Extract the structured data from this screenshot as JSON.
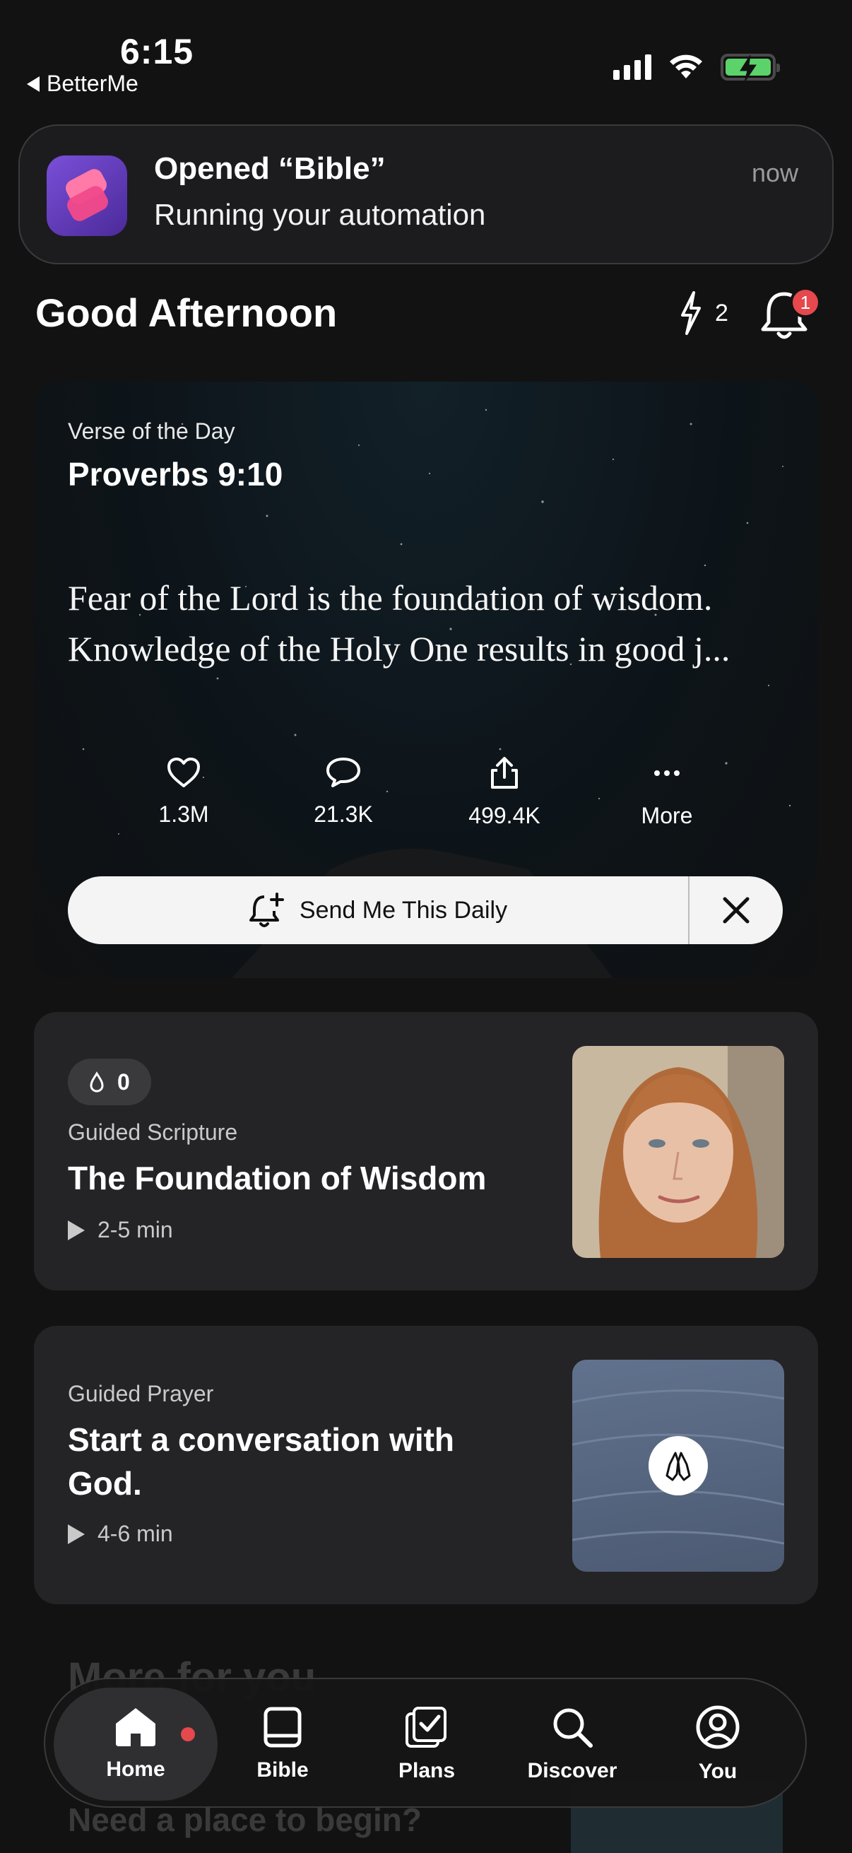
{
  "status_bar": {
    "time": "6:15",
    "back_label": "BetterMe"
  },
  "notification": {
    "title": "Opened “Bible”",
    "subtitle": "Running your automation",
    "time": "now"
  },
  "header": {
    "greeting": "Good Afternoon",
    "streak_count": "2",
    "notification_badge": "1"
  },
  "verse_of_the_day": {
    "label": "Verse of the Day",
    "reference": "Proverbs 9:10",
    "text_line1": "Fear of the Lord is the foundation of wisdom.",
    "text_line2": "Knowledge of the Holy One results in good j...",
    "actions": {
      "like_count": "1.3M",
      "comment_count": "21.3K",
      "share_count": "499.4K",
      "more_label": "More"
    },
    "send_daily_label": "Send Me This Daily"
  },
  "guided_scripture": {
    "streak_count": "0",
    "kind": "Guided Scripture",
    "title": "The Foundation of Wisdom",
    "duration": "2-5 min"
  },
  "guided_prayer": {
    "kind": "Guided Prayer",
    "title": "Start a conversation with God.",
    "duration": "4-6 min"
  },
  "more_section": {
    "title": "More for you",
    "subtitle": "Need a place to begin?"
  },
  "tabs": [
    {
      "label": "Home",
      "icon": "home-icon",
      "active": true
    },
    {
      "label": "Bible",
      "icon": "bible-icon"
    },
    {
      "label": "Plans",
      "icon": "plans-icon"
    },
    {
      "label": "Discover",
      "icon": "search-icon"
    },
    {
      "label": "You",
      "icon": "profile-icon"
    }
  ],
  "colors": {
    "background": "#121212",
    "card": "#242426",
    "badge_red": "#e5484d",
    "battery_green": "#5bd36a"
  }
}
